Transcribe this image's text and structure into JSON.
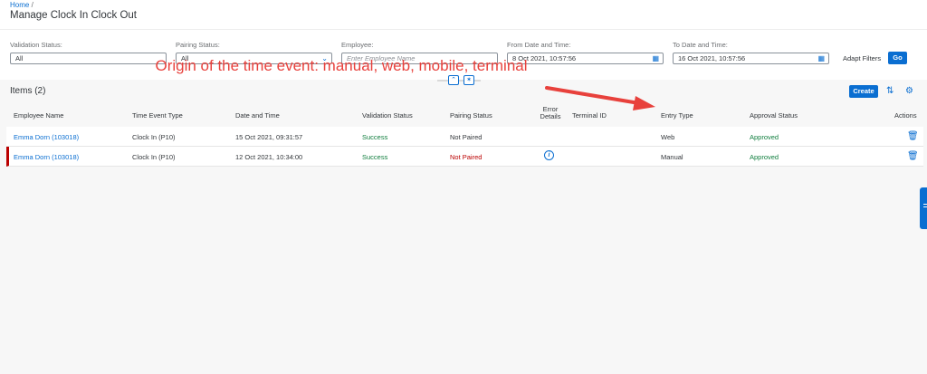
{
  "header": {
    "breadcrumb": "Home",
    "breadcrumb_sep": "/",
    "title": "Manage Clock In Clock Out"
  },
  "filters": [
    {
      "label": "Validation Status:",
      "value": "All",
      "placeholder": ""
    },
    {
      "label": "Pairing Status:",
      "value": "All",
      "placeholder": ""
    },
    {
      "label": "Employee:",
      "value": "",
      "placeholder": "Enter Employee Name"
    },
    {
      "label": "From Date and Time:",
      "value": "8 Oct 2021, 10:57:56",
      "placeholder": ""
    },
    {
      "label": "To Date and Time:",
      "value": "16 Oct 2021, 10:57:56",
      "placeholder": ""
    }
  ],
  "filter_actions": {
    "adapt": "Adapt Filters",
    "go": "Go"
  },
  "annotation": {
    "text": "Origin of the time event: manual, web, mobile, terminal",
    "color": "#e8413c"
  },
  "table": {
    "title": "Items (2)",
    "create_label": "Create",
    "columns": [
      "Employee Name",
      "Time Event Type",
      "Date and Time",
      "Validation Status",
      "Pairing Status",
      "Error Details",
      "Terminal ID",
      "Entry Type",
      "Approval Status",
      "Actions"
    ],
    "rows": [
      {
        "employee": "Emma Dorn (103018)",
        "event_type": "Clock In (P10)",
        "datetime": "15 Oct 2021, 09:31:57",
        "validation": "Success",
        "pairing": "Not Paired",
        "error": false,
        "terminal": "",
        "entry_type": "Web",
        "approval": "Approved"
      },
      {
        "employee": "Emma Dorn (103018)",
        "event_type": "Clock In (P10)",
        "datetime": "12 Oct 2021, 10:34:00",
        "validation": "Success",
        "pairing": "Not Paired",
        "error": true,
        "terminal": "",
        "entry_type": "Manual",
        "approval": "Approved"
      }
    ]
  },
  "colors": {
    "accent": "#0a6ed1",
    "success": "#107e3e",
    "error": "#bb0000"
  },
  "icons": [
    "calendar-icon",
    "collapse-icon",
    "pin-icon",
    "sort-icon",
    "settings-icon",
    "info-icon",
    "delete-icon"
  ]
}
